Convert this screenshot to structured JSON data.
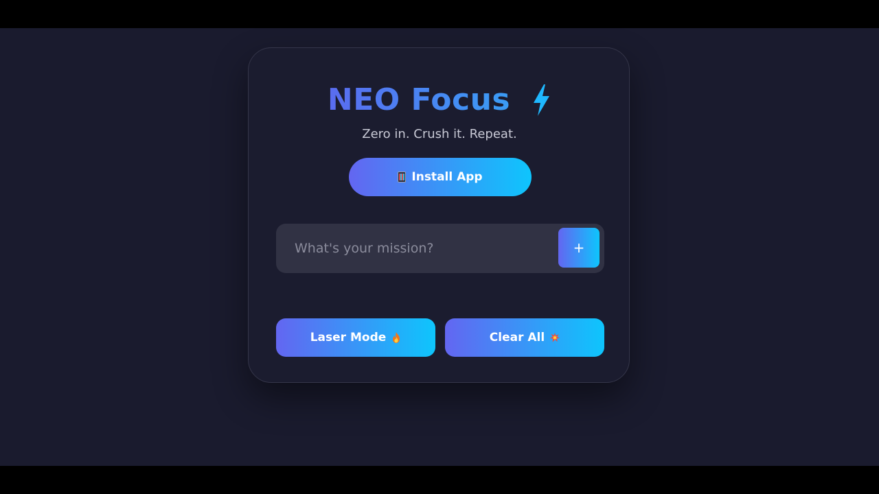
{
  "app": {
    "title": "NEO Focus",
    "subtitle": "Zero in. Crush it. Repeat.",
    "title_icon": "lightning-bolt-icon"
  },
  "install_button": {
    "label": "Install App",
    "icon": "mobile-phone-icon"
  },
  "task_input": {
    "placeholder": "What's your mission?",
    "value": "",
    "add_label": "+"
  },
  "actions": {
    "laser_mode_label": "Laser Mode",
    "laser_mode_icon": "fire-icon",
    "clear_all_label": "Clear All",
    "clear_all_icon": "collision-icon"
  },
  "colors": {
    "background": "#1a1b2e",
    "card": "#1b1c2f",
    "input_bg": "#313244",
    "gradient_start": "#6366f1",
    "gradient_end": "#0ec5fd",
    "bolt": "#1fb8ff"
  }
}
